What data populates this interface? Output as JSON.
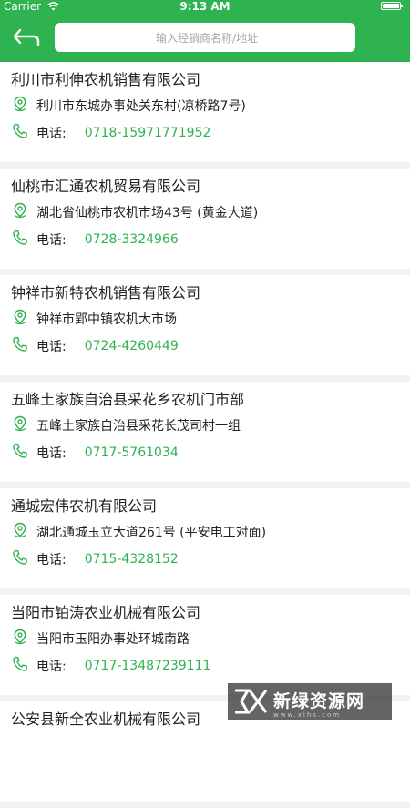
{
  "status_bar": {
    "carrier": "Carrier",
    "time": "9:13 AM"
  },
  "header": {
    "search_placeholder": "输入经销商名称/地址",
    "accent_color": "#2fb350"
  },
  "dealers": [
    {
      "name": "利川市利伸农机销售有限公司",
      "address": "利川市东城办事处关东村(凉桥路7号)",
      "phone_label": "电话:",
      "phone": "0718-15971771952"
    },
    {
      "name": "仙桃市汇通农机贸易有限公司",
      "address": "湖北省仙桃市农机市场43号 (黄金大道)",
      "phone_label": "电话:",
      "phone": "0728-3324966"
    },
    {
      "name": "钟祥市新特农机销售有限公司",
      "address": "钟祥市郢中镇农机大市场",
      "phone_label": "电话:",
      "phone": "0724-4260449"
    },
    {
      "name": "五峰土家族自治县采花乡农机门市部",
      "address": "五峰土家族自治县采花长茂司村一组",
      "phone_label": "电话:",
      "phone": "0717-5761034"
    },
    {
      "name": "通城宏伟农机有限公司",
      "address": "湖北通城玉立大道261号 (平安电工对面)",
      "phone_label": "电话:",
      "phone": "0715-4328152"
    },
    {
      "name": "当阳市铂涛农业机械有限公司",
      "address": "当阳市玉阳办事处环城南路",
      "phone_label": "电话:",
      "phone": "0717-13487239111"
    },
    {
      "name": "公安县新全农业机械有限公司",
      "address": "",
      "phone_label": "",
      "phone": ""
    }
  ],
  "watermark": {
    "text": "新绿资源网",
    "url": "www.xlhs.com"
  }
}
